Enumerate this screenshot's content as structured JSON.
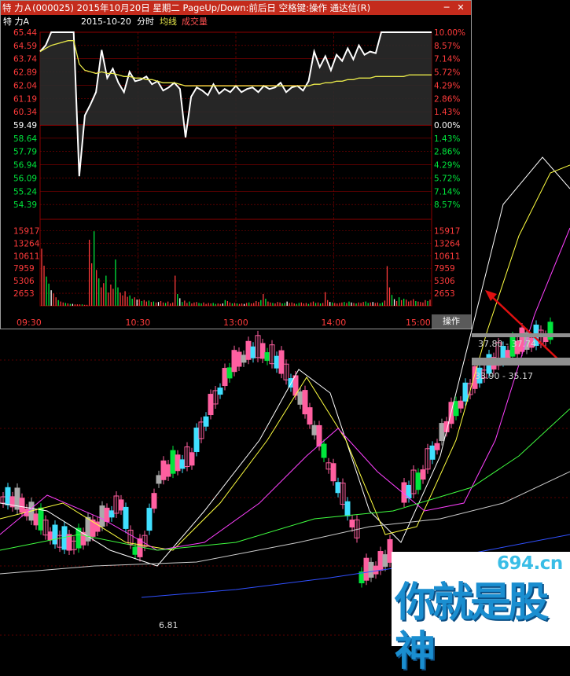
{
  "window": {
    "title": "特 力Ａ(000025) 2015年10月20日 星期二 PageUp/Down:前后日 空格键:操作 通达信(R)",
    "min_icon": "minimize-icon",
    "close_icon": "close-icon"
  },
  "info": {
    "name": "特 力A",
    "date": "2015-10-20",
    "mode": "分时",
    "avg_label": "均线",
    "vol_label": "成交量"
  },
  "operate_label": "操作",
  "colors": {
    "up": "#ff3b3b",
    "down": "#00e63c",
    "flat": "#ffffff",
    "avg": "#e8e84a",
    "grid": "#8b0000",
    "kline_up": "#ff5fa0",
    "kline_down": "#40e0ff"
  },
  "annotations": {
    "range1": "37.80 - 37.74",
    "range2": "33.90 - 35.17",
    "low_label": "6.81"
  },
  "watermark": {
    "site": "694.cn",
    "slogan": "你就是股神"
  },
  "chart_data": [
    {
      "type": "line",
      "title": "",
      "yticks_left": [
        "65.44",
        "64.59",
        "63.74",
        "62.89",
        "62.04",
        "61.19",
        "60.34",
        "59.49",
        "58.64",
        "57.79",
        "56.94",
        "56.09",
        "55.24",
        "54.39"
      ],
      "yticks_right": [
        "10.00%",
        "8.57%",
        "7.14%",
        "5.72%",
        "4.29%",
        "2.86%",
        "1.43%",
        "0.00%",
        "1.43%",
        "2.86%",
        "4.29%",
        "5.72%",
        "7.14%",
        "8.57%"
      ],
      "ylim": [
        53.54,
        65.44
      ],
      "prev_close": 59.49,
      "xticks": [
        "09:30",
        "10:30",
        "13:00",
        "14:00",
        "15:00"
      ],
      "series": [
        {
          "name": "price",
          "values": [
            64.2,
            64.6,
            65.44,
            65.44,
            65.44,
            65.44,
            65.44,
            56.2,
            60.1,
            60.8,
            61.6,
            64.3,
            62.5,
            63.1,
            62.2,
            61.6,
            62.9,
            62.3,
            62.4,
            62.6,
            62.1,
            62.3,
            61.7,
            61.9,
            62.2,
            61.8,
            58.7,
            61.3,
            61.9,
            61.7,
            61.4,
            62.1,
            61.5,
            61.8,
            61.6,
            62.0,
            61.6,
            61.8,
            61.9,
            61.6,
            62.0,
            61.8,
            61.9,
            62.2,
            61.6,
            61.9,
            62.0,
            61.7,
            62.3,
            64.2,
            63.2,
            63.9,
            63.0,
            64.0,
            63.6,
            64.4,
            63.7,
            64.6,
            64.0,
            64.2,
            64.1,
            65.44,
            65.44,
            65.44,
            65.44,
            65.44,
            65.44,
            65.44,
            65.44,
            65.44,
            65.44
          ]
        },
        {
          "name": "均线",
          "values": [
            64.2,
            64.4,
            64.6,
            64.7,
            64.8,
            64.9,
            64.9,
            63.4,
            63.0,
            62.9,
            62.8,
            62.9,
            62.8,
            62.8,
            62.7,
            62.6,
            62.6,
            62.5,
            62.5,
            62.4,
            62.4,
            62.3,
            62.2,
            62.2,
            62.2,
            62.1,
            62.0,
            62.0,
            62.0,
            62.0,
            62.0,
            62.0,
            62.0,
            62.0,
            62.0,
            62.0,
            62.0,
            62.0,
            62.0,
            62.0,
            62.0,
            62.0,
            62.0,
            62.0,
            62.0,
            62.0,
            62.0,
            62.0,
            62.0,
            62.1,
            62.1,
            62.2,
            62.2,
            62.3,
            62.3,
            62.4,
            62.4,
            62.5,
            62.5,
            62.5,
            62.6,
            62.6,
            62.6,
            62.6,
            62.6,
            62.6,
            62.7,
            62.7,
            62.7,
            62.7,
            62.7
          ]
        }
      ]
    },
    {
      "type": "bar",
      "title": "",
      "yticks": [
        "15917",
        "13264",
        "10611",
        "7959",
        "5306",
        "2653"
      ],
      "ylim": [
        0,
        18000
      ],
      "values": [
        12100,
        8500,
        6200,
        4700,
        3300,
        2600,
        1800,
        1200,
        900,
        700,
        600,
        500,
        400,
        400,
        300,
        300,
        300,
        300,
        200,
        200,
        14000,
        9000,
        15800,
        7600,
        5800,
        3900,
        4800,
        6400,
        2800,
        4500,
        3600,
        9800,
        3900,
        2800,
        2200,
        3100,
        1900,
        2200,
        1500,
        1800,
        1300,
        1400,
        1000,
        1200,
        900,
        1100,
        800,
        900,
        700,
        800,
        1000,
        700,
        600,
        900,
        500,
        700,
        6400,
        2500,
        1600,
        800,
        1100,
        600,
        900,
        500,
        700,
        800,
        600,
        500,
        700,
        400,
        600,
        500,
        600,
        400,
        500,
        400,
        500,
        1200,
        1000,
        700,
        500,
        600,
        500,
        400,
        500,
        400,
        600,
        700,
        500,
        600,
        1000,
        800,
        1200,
        2500,
        1500,
        900,
        700,
        600,
        500,
        800,
        700,
        500,
        600,
        900,
        600,
        700,
        500,
        400,
        600,
        700,
        500,
        600,
        400,
        700,
        900,
        600,
        700,
        500,
        600,
        2900,
        1200,
        800,
        700,
        600,
        500,
        600,
        700,
        800,
        600,
        900,
        700,
        600,
        500,
        700,
        600,
        800,
        900,
        600,
        700,
        800,
        600,
        700,
        500,
        700,
        1100,
        8400,
        3900,
        2300,
        1400,
        1000,
        1800,
        1200,
        1500,
        1300,
        900,
        1100,
        1400,
        1000,
        900,
        800,
        700,
        1200,
        1000,
        1300
      ]
    }
  ]
}
